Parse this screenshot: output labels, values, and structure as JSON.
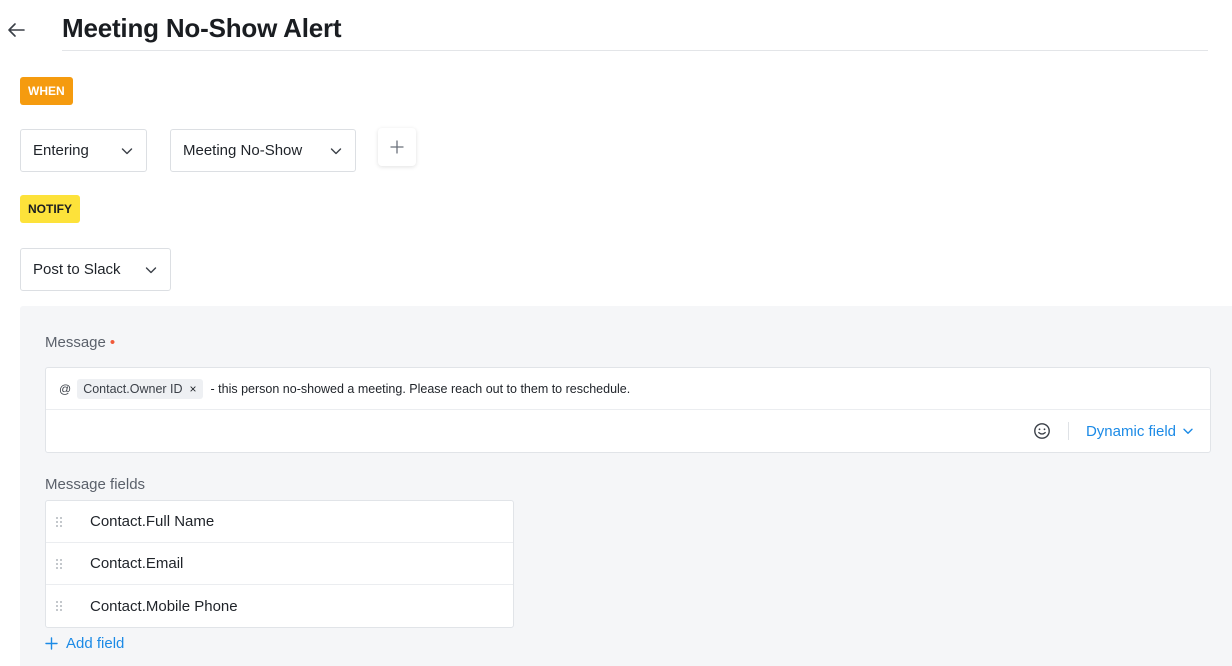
{
  "header": {
    "title": "Meeting No-Show Alert"
  },
  "when": {
    "badge": "WHEN",
    "trigger_select": "Entering",
    "event_select": "Meeting No-Show"
  },
  "notify": {
    "badge": "NOTIFY",
    "channel_select": "Post to Slack"
  },
  "message": {
    "label": "Message",
    "required_marker": "•",
    "at_symbol": "@",
    "chip_label": "Contact.Owner ID",
    "chip_remove": "×",
    "text": "- this person no-showed a meeting. Please reach out to them to reschedule.",
    "dynamic_field_label": "Dynamic field"
  },
  "message_fields": {
    "label": "Message fields",
    "items": [
      {
        "label": "Contact.Full Name"
      },
      {
        "label": "Contact.Email"
      },
      {
        "label": "Contact.Mobile Phone"
      }
    ],
    "add_label": "Add field"
  },
  "colors": {
    "when_badge": "#f59b0f",
    "notify_badge": "#fde23a",
    "link_blue": "#1b8ae6",
    "required_dot": "#f05a3a"
  }
}
